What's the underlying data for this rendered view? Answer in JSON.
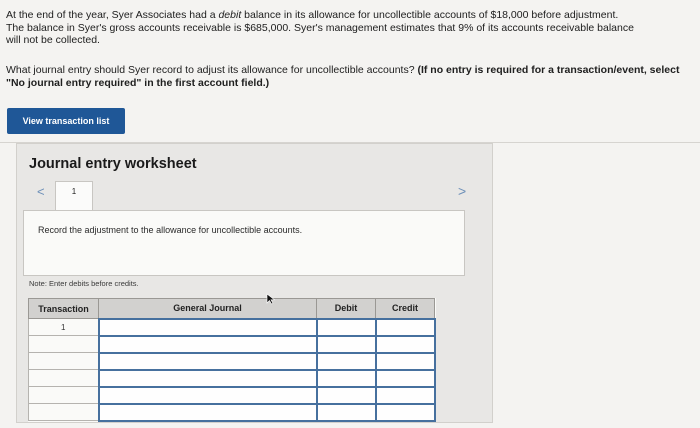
{
  "problem": {
    "lines": [
      "At the end of the year, Syer Associates had a ",
      "debit",
      " balance in its allowance for uncollectible accounts of $18,000 before adjustment.",
      "The balance in Syer's gross accounts receivable is $685,000. Syer's management estimates that 9% of its accounts receivable balance",
      "will not be collected."
    ]
  },
  "question": {
    "text": "What journal entry should Syer record to adjust its allowance for uncollectible accounts? ",
    "bold_text": "(If no entry is required for a transaction/event, select \"No journal entry required\" in the first account field.)"
  },
  "buttons": {
    "view_transaction_list": "View transaction list"
  },
  "worksheet": {
    "title": "Journal entry worksheet",
    "prev_arrow": "<",
    "next_arrow": ">",
    "tab_label": "1",
    "instruction": "Record the adjustment to the allowance for uncollectible accounts.",
    "note": "Note: Enter debits before credits."
  },
  "journal_table": {
    "headers": [
      "Transaction",
      "General Journal",
      "Debit",
      "Credit"
    ],
    "rows": [
      {
        "transaction": "1",
        "account": "",
        "debit": "",
        "credit": ""
      },
      {
        "transaction": "",
        "account": "",
        "debit": "",
        "credit": ""
      },
      {
        "transaction": "",
        "account": "",
        "debit": "",
        "credit": ""
      },
      {
        "transaction": "",
        "account": "",
        "debit": "",
        "credit": ""
      },
      {
        "transaction": "",
        "account": "",
        "debit": "",
        "credit": ""
      },
      {
        "transaction": "",
        "account": "",
        "debit": "",
        "credit": ""
      }
    ]
  },
  "icons": {
    "prev": "chevron-left-icon",
    "next": "chevron-right-icon",
    "cursor": "mouse-cursor-icon"
  },
  "colors": {
    "button_bg": "#1f5797",
    "input_border": "#46709e",
    "arrow": "#6c8fb8"
  }
}
